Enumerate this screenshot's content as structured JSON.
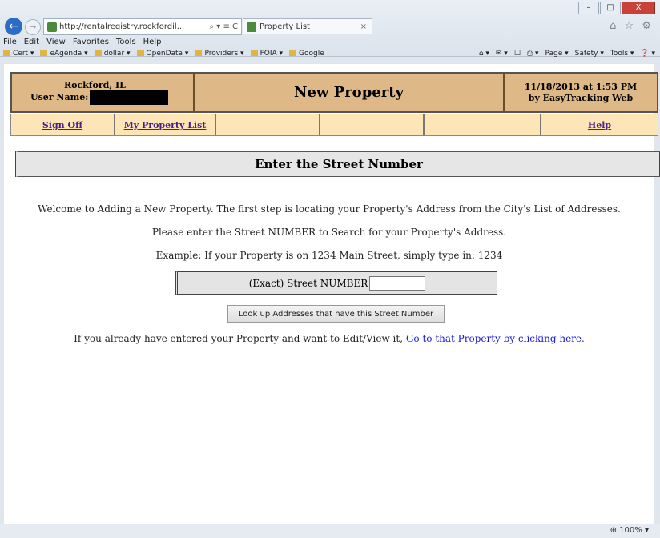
{
  "browser": {
    "address": "http://rentalregistry.rockfordil...",
    "address_controls": "⌕ ▾ ≡ C",
    "tab_title": "Property List",
    "tab_close": "×",
    "toolbar_icons": "⌂ ☆ ⚙",
    "window_buttons": [
      "–",
      "□",
      "X"
    ],
    "menu": [
      "File",
      "Edit",
      "View",
      "Favorites",
      "Tools",
      "Help"
    ],
    "favorites": [
      "Cert ▾",
      "eAgenda ▾",
      "dollar ▾",
      "OpenData ▾",
      "Providers ▾",
      "FOIA ▾",
      "Google"
    ],
    "commands": [
      "⌂ ▾",
      "✉ ▾",
      "☐",
      "⎙ ▾",
      "Page ▾",
      "Safety ▾",
      "Tools ▾",
      "❓ ▾"
    ],
    "zoom": "⊕ 100%  ▾"
  },
  "header": {
    "city": "Rockford, IL",
    "user_label": "User Name:",
    "title": "New Property",
    "datetime": "11/18/2013 at 1:53 PM",
    "by": "by EasyTracking Web"
  },
  "nav": {
    "sign_off": "Sign Off",
    "my_property_list": "My Property List",
    "help": "Help"
  },
  "section": {
    "title": "Enter the Street Number"
  },
  "content": {
    "welcome": "Welcome to Adding a New Property. The first step is locating your Property's Address from the City's List of Addresses.",
    "instruction": "Please enter the Street NUMBER to Search for your Property's Address.",
    "example": "Example: If your Property is on 1234 Main Street, simply type in: 1234",
    "field_label": "(Exact) Street NUMBER",
    "field_value": "",
    "lookup_button": "Look up Addresses that have this Street Number",
    "edit_text": "If you already have entered your Property and want to Edit/View it, ",
    "edit_link": "Go to that Property by clicking here."
  }
}
